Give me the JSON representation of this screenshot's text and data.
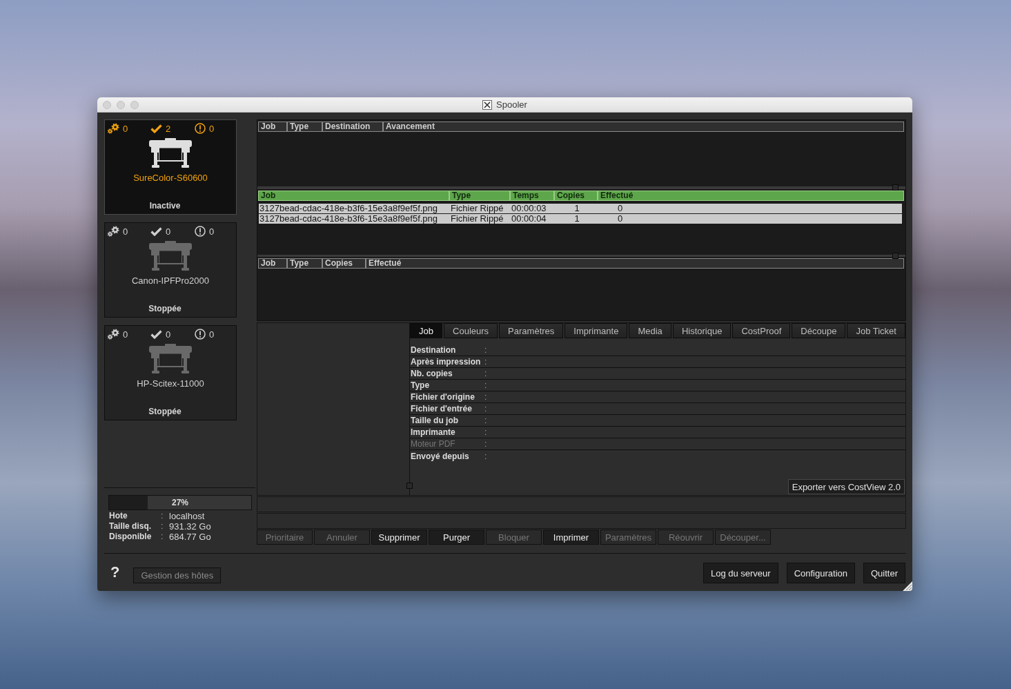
{
  "window": {
    "title": "Spooler"
  },
  "printers": [
    {
      "name": "SureColor-S60600",
      "status": "Inactive",
      "selected": true,
      "processing": "0",
      "done": "2",
      "errors": "0"
    },
    {
      "name": "Canon-IPFPro2000",
      "status": "Stoppée",
      "selected": false,
      "processing": "0",
      "done": "0",
      "errors": "0"
    },
    {
      "name": "HP-Scitex-11000",
      "status": "Stoppée",
      "selected": false,
      "processing": "0",
      "done": "0",
      "errors": "0"
    }
  ],
  "queue_table": {
    "columns": [
      "Job",
      "Type",
      "Destination",
      "Avancement"
    ]
  },
  "jobs_table": {
    "columns": [
      "Job",
      "Type",
      "Temps",
      "Copies",
      "Effectué"
    ],
    "rows": [
      [
        "3127bead-cdac-418e-b3f6-15e3a8f9ef5f.png",
        "Fichier Rippé",
        "00:00:03",
        "1",
        "0"
      ],
      [
        "3127bead-cdac-418e-b3f6-15e3a8f9ef5f.png",
        "Fichier Rippé",
        "00:00:04",
        "1",
        "0"
      ]
    ]
  },
  "held_table": {
    "columns": [
      "Job",
      "Type",
      "Copies",
      "Effectué"
    ]
  },
  "tabs": [
    {
      "label": "Job",
      "selected": true
    },
    {
      "label": "Couleurs",
      "selected": false
    },
    {
      "label": "Paramètres",
      "selected": false
    },
    {
      "label": "Imprimante",
      "selected": false
    },
    {
      "label": "Media",
      "selected": false
    },
    {
      "label": "Historique",
      "selected": false
    },
    {
      "label": "CostProof",
      "selected": false
    },
    {
      "label": "Découpe",
      "selected": false
    },
    {
      "label": "Job Ticket",
      "selected": false
    }
  ],
  "job_fields": [
    {
      "label": "Destination",
      "separator": ":",
      "disabled": false
    },
    {
      "label": "Après impression",
      "separator": ":",
      "disabled": false
    },
    {
      "label": "Nb. copies",
      "separator": ":",
      "disabled": false
    },
    {
      "label": "Type",
      "separator": ":",
      "disabled": false
    },
    {
      "label": "Fichier d'origine",
      "separator": ":",
      "disabled": false
    },
    {
      "label": "Fichier d'entrée",
      "separator": ":",
      "disabled": false
    },
    {
      "label": "Taille du job",
      "separator": ":",
      "disabled": false
    },
    {
      "label": "Imprimante",
      "separator": ":",
      "disabled": false
    },
    {
      "label": "Moteur PDF",
      "separator": ":",
      "disabled": true
    },
    {
      "label": "Envoyé depuis",
      "separator": ":",
      "disabled": false
    }
  ],
  "export_button": "Exporter vers CostView 2.0",
  "actions": [
    {
      "label": "Prioritaire",
      "disabled": true
    },
    {
      "label": "Annuler",
      "disabled": true
    },
    {
      "label": "Supprimer",
      "disabled": false
    },
    {
      "label": "Purger",
      "disabled": false
    },
    {
      "label": "Bloquer",
      "disabled": true
    },
    {
      "label": "Imprimer",
      "disabled": false
    },
    {
      "label": "Paramètres",
      "disabled": true
    },
    {
      "label": "Réouvrir",
      "disabled": true
    },
    {
      "label": "Découper...",
      "disabled": true
    }
  ],
  "disk": {
    "level": 0.27,
    "reading": "27%",
    "rows": [
      {
        "label": "Hote",
        "separator": ":",
        "value": "localhost"
      },
      {
        "label": "Taille disq.",
        "separator": ":",
        "value": "931.32 Go"
      },
      {
        "label": "Disponible",
        "separator": ":",
        "value": "684.77 Go"
      }
    ]
  },
  "footer": {
    "help": "?",
    "hosts_button": {
      "label": "Gestion des hôtes",
      "disabled": true
    },
    "buttons": [
      "Log du serveur",
      "Configuration",
      "Quitter"
    ]
  }
}
